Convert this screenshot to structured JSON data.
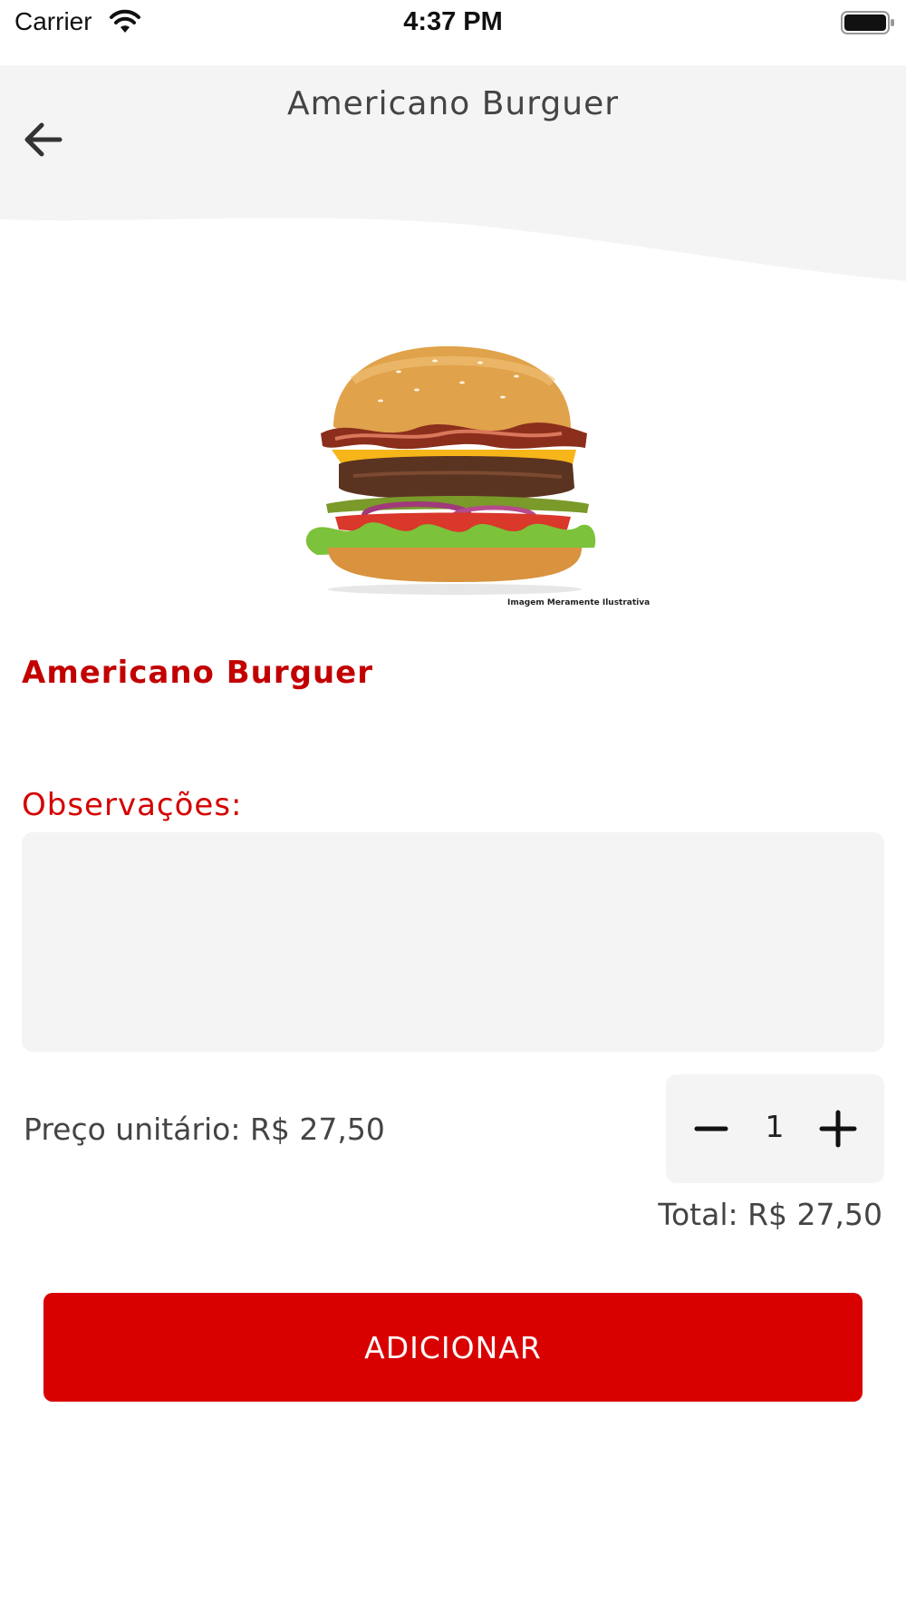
{
  "status_bar": {
    "carrier": "Carrier",
    "time": "4:37 PM"
  },
  "header": {
    "title": "Americano Burguer",
    "back_icon": "arrow-left-icon"
  },
  "product": {
    "image_caption": "Imagem Meramente Ilustrativa",
    "name": "Americano Burguer"
  },
  "observations": {
    "label": "Observações:",
    "value": ""
  },
  "pricing": {
    "unit_price": "Preço unitário: R$ 27,50",
    "quantity": "1",
    "total": "Total: R$ 27,50"
  },
  "actions": {
    "add_label": "ADICIONAR"
  },
  "colors": {
    "accent": "#d90000",
    "label_red": "#c20000",
    "panel_gray": "#f4f4f4"
  }
}
